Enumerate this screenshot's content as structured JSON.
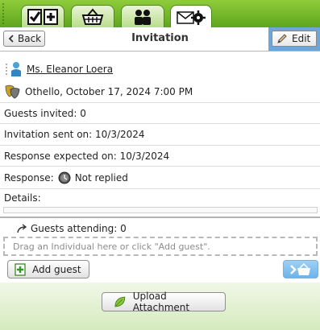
{
  "tabs": [
    {
      "name": "tasks-tab",
      "icon": "checklist-plus-icon"
    },
    {
      "name": "shop-tab",
      "icon": "basket-icon"
    },
    {
      "name": "people-tab",
      "icon": "people-icon"
    },
    {
      "name": "invitations-tab",
      "icon": "mail-gear-icon"
    }
  ],
  "header": {
    "back_label": "Back",
    "title": "Invitation",
    "edit_label": "Edit"
  },
  "invitation": {
    "guest_name": "Ms. Eleanor Loera",
    "event": "Othello, October 17, 2024 7:00 PM",
    "guests_invited": "Guests invited: 0",
    "sent_on": "Invitation sent on: 10/3/2024",
    "response_expected": "Response expected on: 10/3/2024",
    "response_label": "Response:",
    "response_value": "Not replied",
    "details_label": "Details:"
  },
  "guests": {
    "attending": "Guests attending: 0",
    "dropzone_text": "Drag an Individual here or click \"Add guest\".",
    "add_guest_label": "Add guest"
  },
  "footer": {
    "upload_label": "Upload Attachment"
  },
  "colors": {
    "tabbar": "#6fb42a",
    "edit_highlight": "#6ea6d8"
  }
}
